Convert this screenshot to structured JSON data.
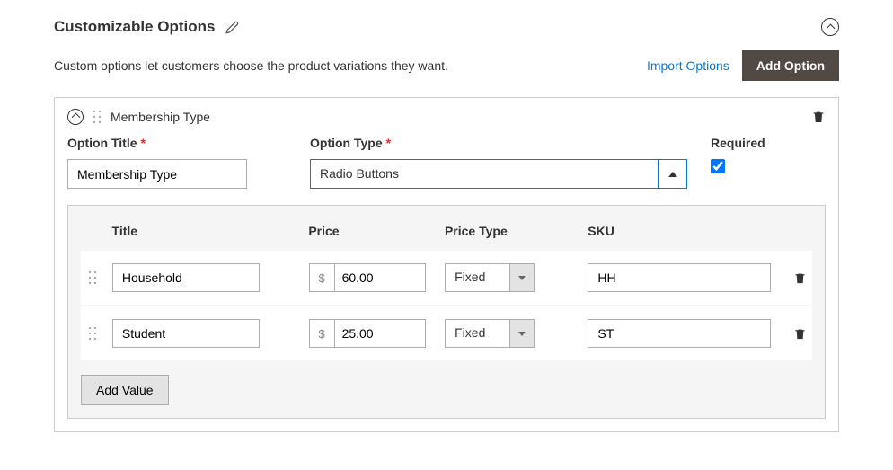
{
  "section": {
    "title": "Customizable Options",
    "description": "Custom options let customers choose the product variations they want.",
    "import_label": "Import Options",
    "add_option_label": "Add Option"
  },
  "option": {
    "name": "Membership Type",
    "title_label": "Option Title",
    "title_value": "Membership Type",
    "type_label": "Option Type",
    "type_value": "Radio Buttons",
    "required_label": "Required",
    "required_checked": true
  },
  "values_header": {
    "title": "Title",
    "price": "Price",
    "price_type": "Price Type",
    "sku": "SKU"
  },
  "values": [
    {
      "title": "Household",
      "price": "60.00",
      "price_type": "Fixed",
      "sku": "HH"
    },
    {
      "title": "Student",
      "price": "25.00",
      "price_type": "Fixed",
      "sku": "ST"
    }
  ],
  "add_value_label": "Add Value",
  "currency_symbol": "$"
}
